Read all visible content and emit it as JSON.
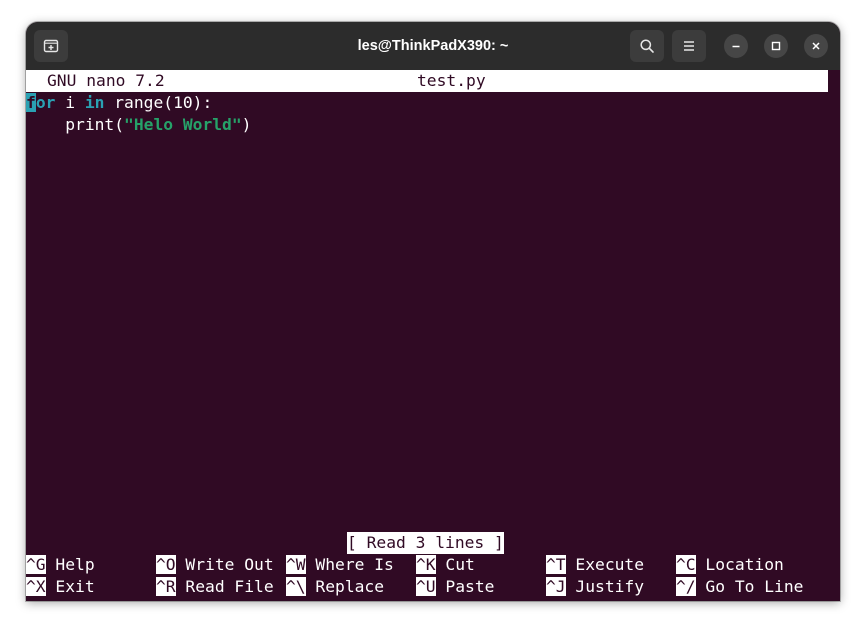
{
  "window": {
    "title": "les@ThinkPadX390: ~"
  },
  "icons": {
    "new_tab": "new-tab-icon",
    "search": "search-icon",
    "menu": "hamburger-menu-icon",
    "minimize": "minimize-icon",
    "maximize": "maximize-icon",
    "close": "close-icon"
  },
  "nano": {
    "version": "GNU nano 7.2",
    "filename": "test.py",
    "status": "[ Read 3 lines ]"
  },
  "code": {
    "line1": {
      "cursor_char": "f",
      "kw_for_rest": "or",
      "space1": " i ",
      "kw_in": "in",
      "rest": " range(10):"
    },
    "line2": {
      "indent": "    print(",
      "string": "\"Helo World\"",
      "close": ")"
    }
  },
  "shortcuts": [
    {
      "key": "^G",
      "label": "Help"
    },
    {
      "key": "^O",
      "label": "Write Out"
    },
    {
      "key": "^W",
      "label": "Where Is"
    },
    {
      "key": "^K",
      "label": "Cut"
    },
    {
      "key": "^T",
      "label": "Execute"
    },
    {
      "key": "^C",
      "label": "Location"
    },
    {
      "key": "^X",
      "label": "Exit"
    },
    {
      "key": "^R",
      "label": "Read File"
    },
    {
      "key": "^\\",
      "label": "Replace"
    },
    {
      "key": "^U",
      "label": "Paste"
    },
    {
      "key": "^J",
      "label": "Justify"
    },
    {
      "key": "^/",
      "label": "Go To Line"
    }
  ],
  "colors": {
    "terminal_bg": "#300a24",
    "keyword": "#2aa1b3",
    "string": "#26a269",
    "titlebar": "#2c2c2c"
  }
}
